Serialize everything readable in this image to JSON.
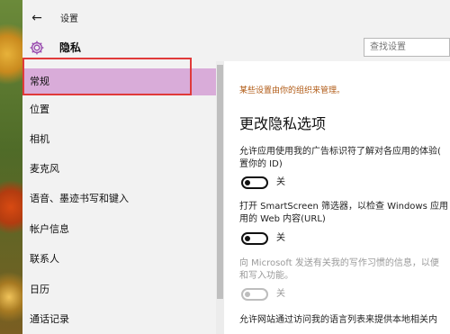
{
  "window": {
    "title": "设置",
    "back_glyph": "←"
  },
  "header": {
    "title": "隐私",
    "search": {
      "placeholder": "查找设置",
      "value": ""
    }
  },
  "sidebar": {
    "items": [
      {
        "label": "常规",
        "selected": true
      },
      {
        "label": "位置"
      },
      {
        "label": "相机"
      },
      {
        "label": "麦克风"
      },
      {
        "label": "语音、墨迹书写和键入"
      },
      {
        "label": "帐户信息"
      },
      {
        "label": "联系人"
      },
      {
        "label": "日历"
      },
      {
        "label": "通话记录"
      }
    ]
  },
  "main": {
    "managed_notice": "某些设置由你的组织来管理。",
    "section_title": "更改隐私选项",
    "settings": [
      {
        "line1": "允许应用使用我的广告标识符了解对各应用的体验(",
        "line2": "置你的 ID)",
        "state": "关",
        "enabled": true
      },
      {
        "line1": "打开 SmartScreen 筛选器，以检查 Windows 应用",
        "line2": "用的 Web 内容(URL)",
        "state": "关",
        "enabled": true
      },
      {
        "line1": "向 Microsoft 发送有关我的写作习惯的信息，以便",
        "line2": "和写入功能。",
        "state": "关",
        "enabled": false
      },
      {
        "line1": "允许网站通过访问我的语言列表来提供本地相关内",
        "line2": "",
        "state": "",
        "enabled": true
      }
    ]
  },
  "colors": {
    "accent_selected": "#d9acd9",
    "highlight_box": "#e03a3a",
    "managed_text": "#b05a14"
  },
  "icons": {
    "back": "back-arrow-icon",
    "settings": "gear-icon"
  }
}
